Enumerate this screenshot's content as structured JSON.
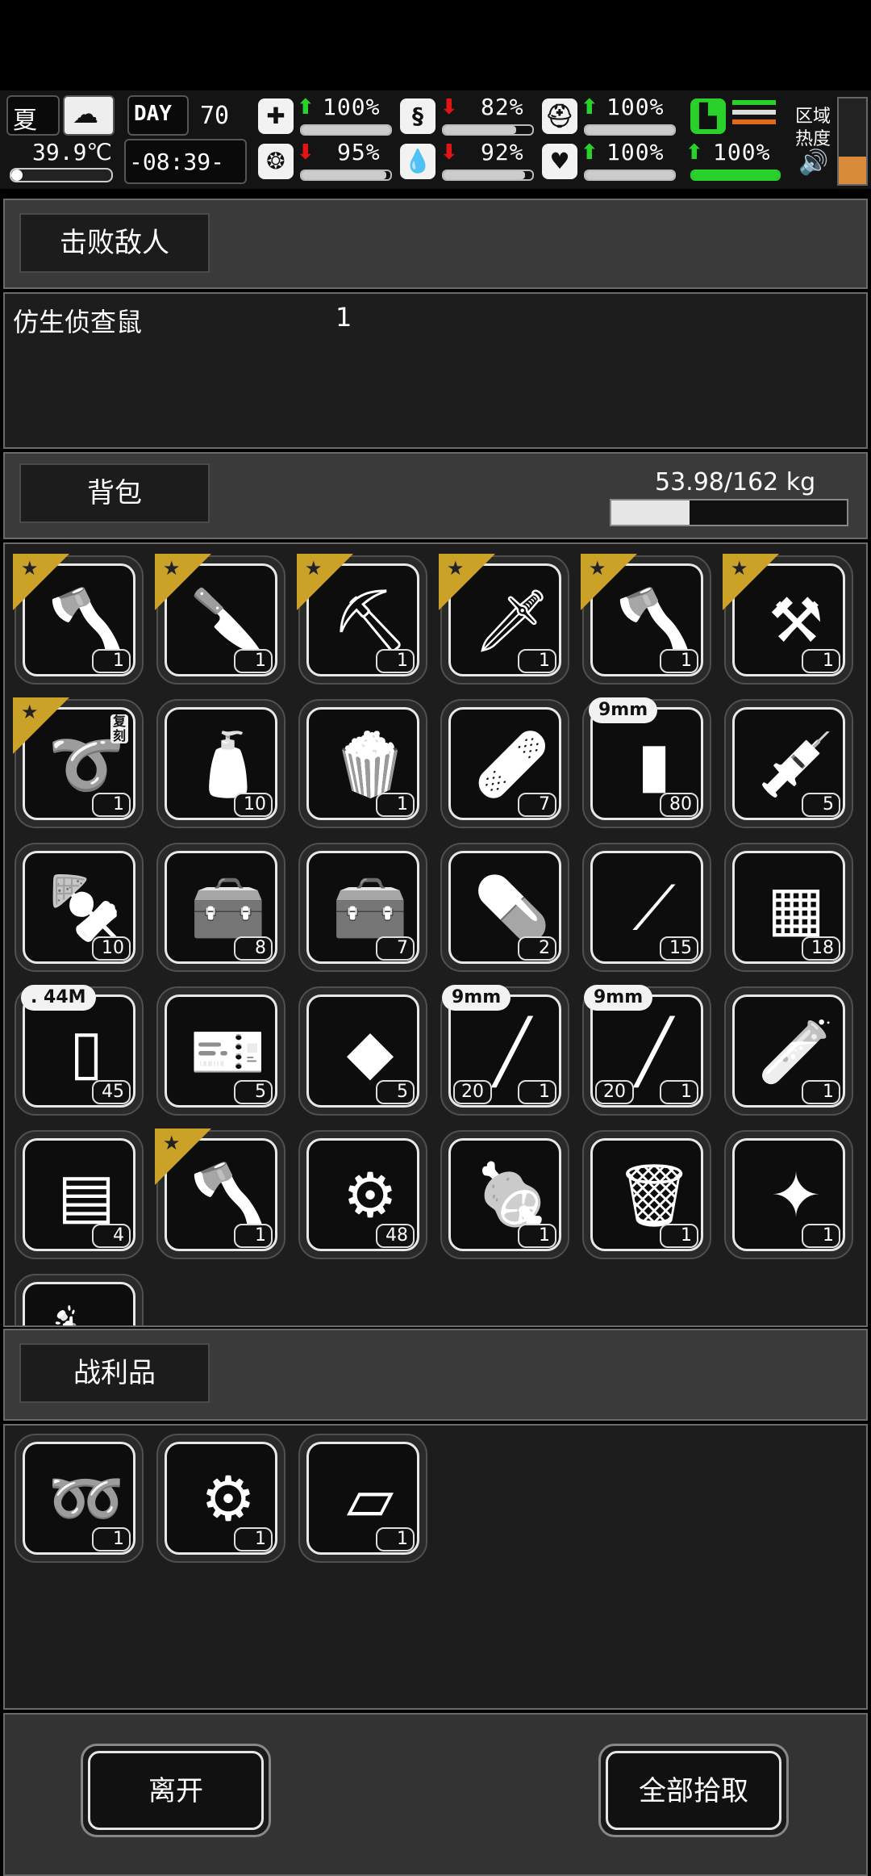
{
  "hud": {
    "season": "夏",
    "temperature": "39.9℃",
    "day_label": "DAY",
    "day": "70",
    "time": "-08:39-",
    "zone_heat": [
      "区域",
      "热度"
    ],
    "stats": [
      {
        "icon": "medkit-icon",
        "arrow": "up",
        "value": "100%",
        "fill": 1.0
      },
      {
        "icon": "stomach-icon",
        "arrow": "down",
        "value": "82%",
        "fill": 0.82
      },
      {
        "icon": "helmet-icon",
        "arrow": "up",
        "value": "100%",
        "fill": 1.0
      },
      {
        "icon": "brain-icon",
        "arrow": "down",
        "value": "95%",
        "fill": 0.95
      },
      {
        "icon": "water-drop-icon",
        "arrow": "down",
        "value": "92%",
        "fill": 0.92
      },
      {
        "icon": "heart-icon",
        "arrow": "up",
        "value": "100%",
        "fill": 1.0
      }
    ],
    "stamina": {
      "value": "100%",
      "fill": 1.0
    }
  },
  "defeated": {
    "button": "击败敌人",
    "entries": [
      {
        "name": "仿生侦查鼠",
        "count": "1"
      }
    ]
  },
  "backpack": {
    "button": "背包",
    "weight": "53.98/162 kg",
    "weight_fill": 0.333
  },
  "loot": {
    "button": "战利品"
  },
  "actions": {
    "leave": "离开",
    "take_all": "全部拾取"
  },
  "inventory": [
    {
      "icon": "axe-icon",
      "count": "1",
      "starred": true
    },
    {
      "icon": "multitool-knife-icon",
      "count": "1",
      "starred": true
    },
    {
      "icon": "shovel-icon",
      "count": "1",
      "starred": true
    },
    {
      "icon": "chisel-icon",
      "count": "1",
      "starred": true
    },
    {
      "icon": "axe-icon",
      "count": "1",
      "starred": true
    },
    {
      "icon": "hammer-axe-icon",
      "count": "1",
      "starred": true
    },
    {
      "icon": "whip-icon",
      "count": "1",
      "starred": true,
      "badge": "复刻"
    },
    {
      "icon": "water-bottle-icon",
      "count": "10"
    },
    {
      "icon": "popcorn-icon",
      "count": "1"
    },
    {
      "icon": "bandage-roll-icon",
      "count": "7"
    },
    {
      "icon": "bullet-icon",
      "count": "80",
      "tag": "9mm"
    },
    {
      "icon": "syringe-icon",
      "count": "5"
    },
    {
      "icon": "skewer-icon",
      "count": "10"
    },
    {
      "icon": "toolbox-icon",
      "count": "8"
    },
    {
      "icon": "toolbox-icon",
      "count": "7"
    },
    {
      "icon": "pill-bottle-icon",
      "count": "2"
    },
    {
      "icon": "tweezers-icon",
      "count": "15"
    },
    {
      "icon": "net-icon",
      "count": "18"
    },
    {
      "icon": "battery-cell-icon",
      "count": "45",
      "tag": ". 44M"
    },
    {
      "icon": "blueprint-ticket-icon",
      "count": "5"
    },
    {
      "icon": "scrap-pieces-icon",
      "count": "5"
    },
    {
      "icon": "barrel-icon",
      "count": "1",
      "count2": "20",
      "tag": "9mm"
    },
    {
      "icon": "barrel-icon",
      "count": "1",
      "count2": "20",
      "tag": "9mm"
    },
    {
      "icon": "test-tube-icon",
      "count": "1"
    },
    {
      "icon": "cloth-icon",
      "count": "4"
    },
    {
      "icon": "axe-icon",
      "count": "1",
      "starred": true
    },
    {
      "icon": "scrap-metal-icon",
      "count": "48"
    },
    {
      "icon": "meat-icon",
      "count": "1"
    },
    {
      "icon": "trash-icon",
      "count": "1"
    },
    {
      "icon": "crumpled-paper-icon",
      "count": "1"
    },
    {
      "icon": "glass-bottle-icon",
      "count": ""
    }
  ],
  "loot_items": [
    {
      "icon": "spring-icon",
      "count": "1"
    },
    {
      "icon": "scrap-metal-icon",
      "count": "1"
    },
    {
      "icon": "metal-sheet-icon",
      "count": "1"
    }
  ]
}
